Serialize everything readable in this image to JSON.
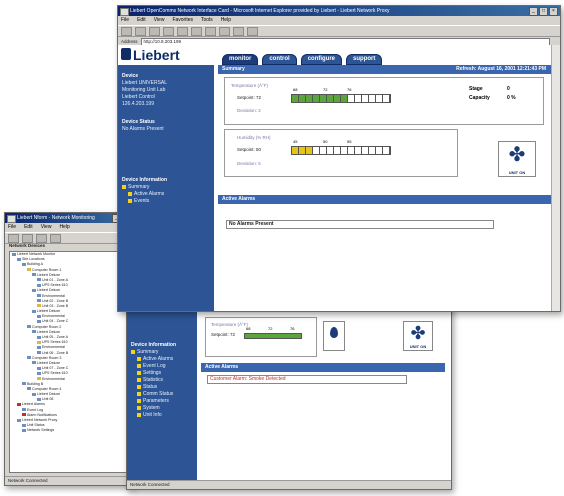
{
  "front_window": {
    "title": "Liebert OpenComms Network Interface Card - Microsoft Internet Explorer provided by Liebert - Liebert Network Proxy",
    "menu": [
      "File",
      "Edit",
      "View",
      "Favorites",
      "Tools",
      "Help"
    ],
    "address_label": "Address",
    "address_value": "http://10.8.203.199",
    "logo": "Liebert",
    "tabs": [
      "monitor",
      "control",
      "configure",
      "support"
    ],
    "sidebar": {
      "device_heading": "Device",
      "device_lines": [
        "Liebert UNIVERSAL",
        "Monitoring Unit Lab",
        "Liebert Control",
        "126.4.203.199"
      ],
      "status_heading": "Device Status",
      "status_value": "No Alarms Present",
      "info_heading": "Device Information",
      "info_items": [
        "Summary",
        "Active Alarms",
        "Events"
      ]
    },
    "summary": {
      "label": "Summary",
      "timestamp": "Refresh: August 16, 2001 12:21:43 PM"
    },
    "temperature": {
      "title": "Temperature (Â°F)",
      "setpoint_label": "Setpoint: 72",
      "dev_label": "Deviation: 2",
      "scale_low": "68",
      "scale_mid": "72",
      "scale_high": "76",
      "fill_fraction": 0.54,
      "stage_label": "Stage",
      "stage_value": "0",
      "capacity_label": "Capacity",
      "capacity_value": "0 %"
    },
    "humidity": {
      "title": "Humidity (% RH)",
      "setpoint_label": "Setpoint: 50",
      "dev_label": "Deviation: 5",
      "scale_low": "45",
      "scale_mid": "50",
      "scale_high": "55",
      "fill_fraction": 0.22
    },
    "unit_label": "UNIT ON",
    "alarms_heading": "Active Alarms",
    "alarms_message": "No Alarms Present"
  },
  "back_window": {
    "title": "Liebert Nform - Network Monitoring",
    "tree_title": "Network Devices",
    "tree_items": [
      "Liebert Network Monitor",
      "Site Locations",
      "Building A",
      "Computer Room 1",
      "Liebert Deluxe",
      "Unit 01 - Zone A",
      "UPS Series 610",
      "Liebert Deluxe",
      "Environmental",
      "Unit 02 - Zone B",
      "Unit 03 - Zone B",
      "Liebert Deluxe",
      "Environmental",
      "Unit 04 - Zone C",
      "Computer Room 2",
      "Liebert Deluxe",
      "Unit 05 - Zone A",
      "UPS Series 610",
      "Environmental",
      "Unit 06 - Zone B",
      "Computer Room 3",
      "Liebert Deluxe",
      "Unit 07 - Zone C",
      "UPS Series 610",
      "Environmental",
      "Building B",
      "Computer Room 4",
      "Liebert Deluxe",
      "Unit 08",
      "Liebert Alarms",
      "Event Log",
      "Alarm Notifications",
      "Liebert Network Proxy",
      "Unit Status",
      "Network Settings"
    ],
    "status": "Network Connected",
    "inner_temperature_title": "Temperature (Â°F)",
    "inner_setpoint": "Setpoint: 72",
    "inner_scale": [
      "68",
      "72",
      "76"
    ],
    "inner_sidebar_heading": "Device Information",
    "inner_sidebar_items": [
      "Summary",
      "Active Alarms",
      "Event Log",
      "Settings",
      "Statistics",
      "Status",
      "Comm Status",
      "Parameters",
      "System",
      "Unit Info"
    ],
    "inner_alarms_heading": "Active Alarms",
    "inner_alarms_message": "Customer Alarm: Smoke Detected",
    "unit_label": "UNIT ON"
  },
  "colors": {
    "liebert_blue": "#2d5596",
    "dark_navy": "#0e2c66",
    "gauge_green": "#5aa63a",
    "gauge_yellow": "#e6c414",
    "alarm_red": "#c03030"
  }
}
